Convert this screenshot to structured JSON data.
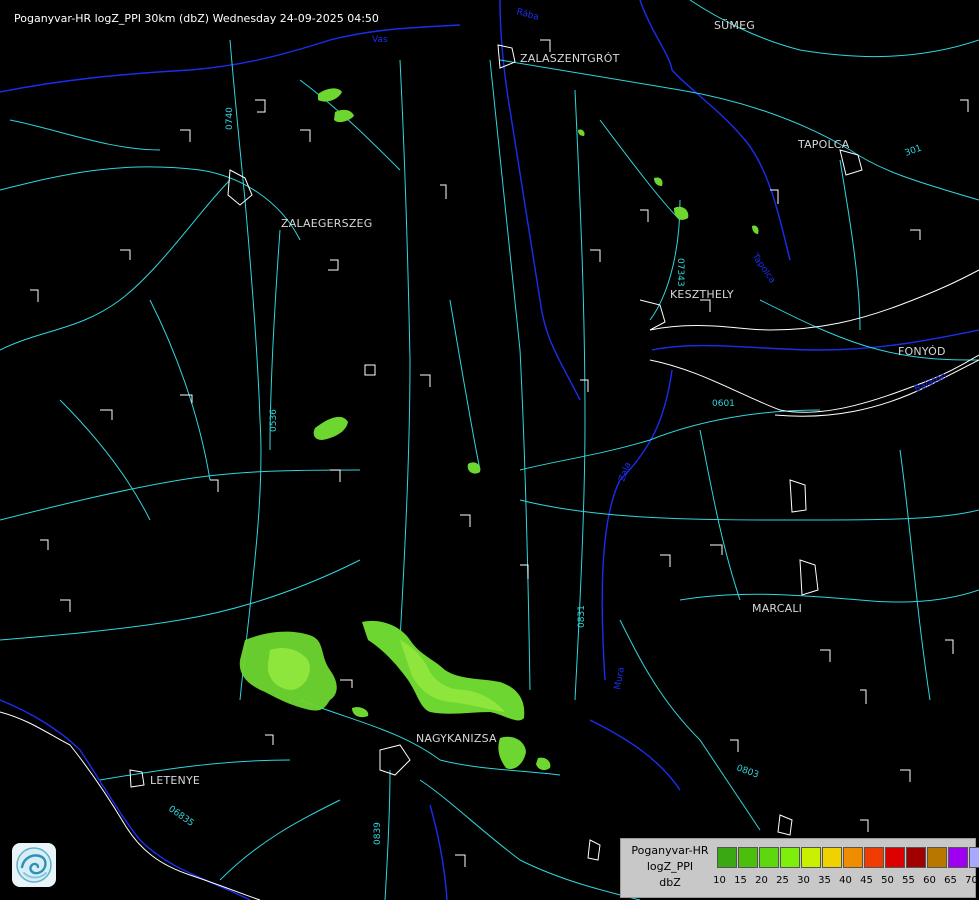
{
  "header": {
    "title": "Poganyvar-HR logZ_PPI 30km (dbZ) Wednesday 24-09-2025 04:50"
  },
  "towns": [
    {
      "name": "SÜMEG"
    },
    {
      "name": "ZALASZENTGRÓT"
    },
    {
      "name": "TAPOLCA"
    },
    {
      "name": "ZALAEGERSZEG"
    },
    {
      "name": "KESZTHELY"
    },
    {
      "name": "FONYÓD"
    },
    {
      "name": "MARCALI"
    },
    {
      "name": "NAGYKANIZSA"
    },
    {
      "name": "LETENYE"
    }
  ],
  "road_labels": [
    "0740",
    "0536",
    "07343",
    "0831",
    "0803",
    "0839",
    "0601",
    "06835",
    "301"
  ],
  "river_labels": [
    "Vas",
    "Zala",
    "Tapolca",
    "Balaton",
    "Rába",
    "Mura"
  ],
  "legend": {
    "line1": "Poganyvar-HR",
    "line2": "logZ_PPI",
    "line3": "dbZ",
    "ticks": [
      "10",
      "15",
      "20",
      "25",
      "30",
      "35",
      "40",
      "45",
      "50",
      "55",
      "60",
      "65",
      "70"
    ],
    "colors": [
      "#3aa812",
      "#4cbf0c",
      "#5fd70f",
      "#7cf00a",
      "#c8f000",
      "#f0d200",
      "#f08c00",
      "#f03c00",
      "#dc0000",
      "#a00000",
      "#b87800",
      "#a000f0",
      "#a8a8ff"
    ]
  },
  "colors": {
    "roads": "#2fd6dc",
    "rivers": "#1a2ef0",
    "borders": "#ffffff",
    "echo_light": "#8ee63c",
    "echo_dark": "#5ecf1e"
  },
  "logo": {
    "icon": "weather-service-logo-icon"
  }
}
